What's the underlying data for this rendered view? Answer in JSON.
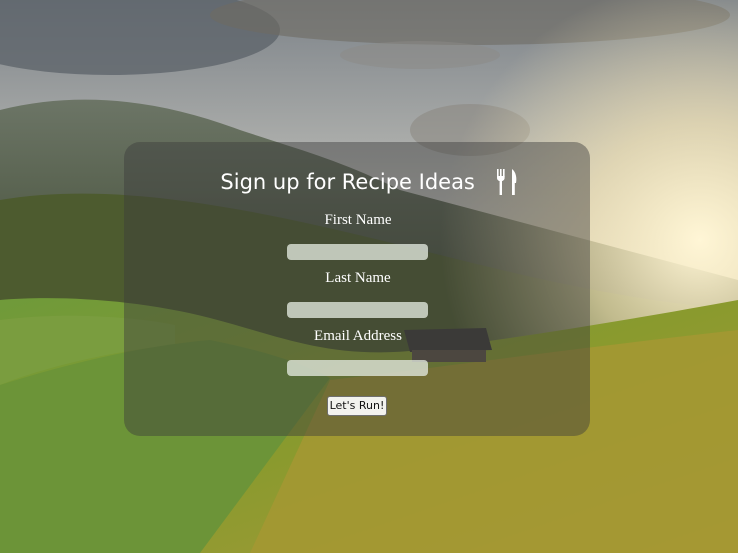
{
  "form": {
    "title": "Sign up for Recipe Ideas",
    "title_icon": "utensils-icon",
    "fields": [
      {
        "label": "First Name",
        "value": ""
      },
      {
        "label": "Last Name",
        "value": ""
      },
      {
        "label": "Email Address",
        "value": ""
      }
    ],
    "submit_label": "Let's Run!"
  },
  "colors": {
    "panel_overlay": "#3c3c3c",
    "text": "#ffffff",
    "input_bg": "#e1e8de"
  }
}
